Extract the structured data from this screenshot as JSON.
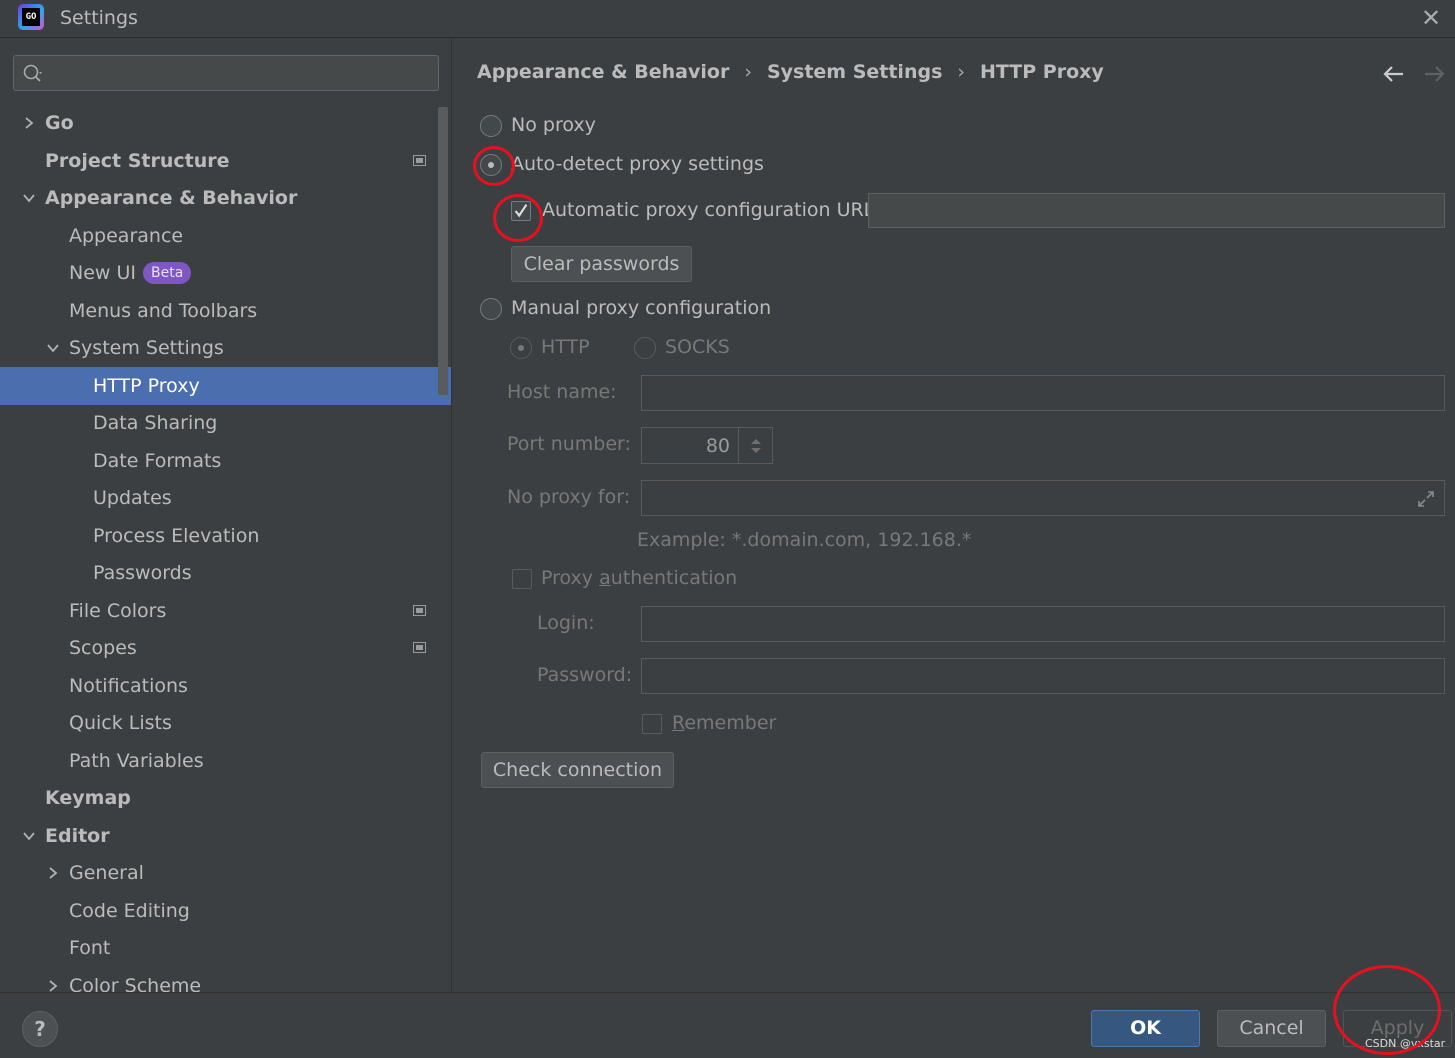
{
  "window": {
    "title": "Settings",
    "logo_text": "GO",
    "close_icon": "close-icon"
  },
  "search": {
    "placeholder": "",
    "icon": "search-icon"
  },
  "sidebar": {
    "items": [
      {
        "label": "Go",
        "level": 0,
        "bold": true,
        "expander": "collapsed"
      },
      {
        "label": "Project Structure",
        "level": 0,
        "bold": true,
        "project_icon": true
      },
      {
        "label": "Appearance & Behavior",
        "level": 0,
        "bold": true,
        "expander": "expanded"
      },
      {
        "label": "Appearance",
        "level": 1
      },
      {
        "label": "New UI",
        "level": 1,
        "badge": "Beta"
      },
      {
        "label": "Menus and Toolbars",
        "level": 1
      },
      {
        "label": "System Settings",
        "level": 1,
        "expander": "expanded"
      },
      {
        "label": "HTTP Proxy",
        "level": 2,
        "selected": true
      },
      {
        "label": "Data Sharing",
        "level": 2
      },
      {
        "label": "Date Formats",
        "level": 2
      },
      {
        "label": "Updates",
        "level": 2
      },
      {
        "label": "Process Elevation",
        "level": 2
      },
      {
        "label": "Passwords",
        "level": 2
      },
      {
        "label": "File Colors",
        "level": 1,
        "project_icon": true
      },
      {
        "label": "Scopes",
        "level": 1,
        "project_icon": true
      },
      {
        "label": "Notifications",
        "level": 1
      },
      {
        "label": "Quick Lists",
        "level": 1
      },
      {
        "label": "Path Variables",
        "level": 1
      },
      {
        "label": "Keymap",
        "level": 0,
        "bold": true
      },
      {
        "label": "Editor",
        "level": 0,
        "bold": true,
        "expander": "expanded"
      },
      {
        "label": "General",
        "level": 1,
        "expander": "collapsed"
      },
      {
        "label": "Code Editing",
        "level": 1
      },
      {
        "label": "Font",
        "level": 1
      },
      {
        "label": "Color Scheme",
        "level": 1,
        "expander": "collapsed"
      }
    ]
  },
  "breadcrumb": [
    "Appearance & Behavior",
    "System Settings",
    "HTTP Proxy"
  ],
  "proxy": {
    "no_proxy_label": "No proxy",
    "auto_detect_label": "Auto-detect proxy settings",
    "auto_config_url_label": "Automatic proxy configuration URL:",
    "auto_config_url_value": "",
    "auto_config_url_checked": true,
    "clear_passwords_label": "Clear passwords",
    "manual_label": "Manual proxy configuration",
    "selected_mode": "auto-detect",
    "http_label": "HTTP",
    "socks_label": "SOCKS",
    "host_name_label": "Host name:",
    "host_name_value": "",
    "port_number_label": "Port number:",
    "port_number_value": "80",
    "no_proxy_for_label": "No proxy for:",
    "no_proxy_for_value": "",
    "example_text": "Example: *.domain.com, 192.168.*",
    "proxy_auth_label_pre": "Proxy ",
    "proxy_auth_label_mnemonic": "a",
    "proxy_auth_label_post": "uthentication",
    "proxy_auth_checked": false,
    "login_label": "Login:",
    "login_value": "",
    "password_label": "Password:",
    "password_value": "",
    "remember_mnemonic": "R",
    "remember_rest": "emember",
    "remember_checked": false,
    "check_connection_label": "Check connection"
  },
  "footer": {
    "help_label": "?",
    "ok_label": "OK",
    "cancel_label": "Cancel",
    "apply_label": "Apply",
    "watermark": "CSDN @vxstar"
  },
  "annotation_color": "#e8101e",
  "colors": {
    "selection": "#4b6eaf",
    "ok_button": "#365880",
    "background": "#3c3f41"
  }
}
